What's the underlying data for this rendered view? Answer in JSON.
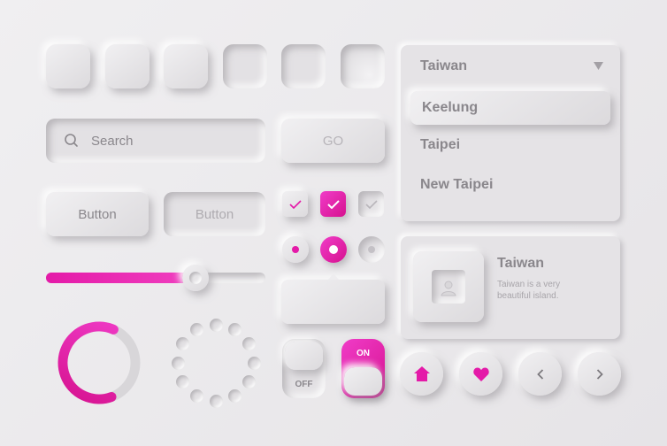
{
  "search": {
    "placeholder": "Search"
  },
  "go_button": {
    "label": "GO"
  },
  "buttons": [
    {
      "label": "Button"
    },
    {
      "label": "Button"
    }
  ],
  "slider": {
    "value_fraction": 0.68
  },
  "progress": {
    "value_fraction": 0.62
  },
  "dropdown": {
    "selected": "Taiwan",
    "options": [
      "Keelung",
      "Taipei",
      "New Taipei"
    ]
  },
  "card": {
    "title": "Taiwan",
    "description_line1": "Taiwan is a very",
    "description_line2": "beautiful island."
  },
  "toggles": [
    {
      "label": "OFF"
    },
    {
      "label": "ON"
    }
  ],
  "icons": [
    "search-icon",
    "check-icon",
    "home-icon",
    "heart-icon",
    "chevron-left-icon",
    "chevron-right-icon",
    "image-placeholder-icon",
    "dropdown-arrow-icon"
  ],
  "colors": {
    "accent": "#e41aa8",
    "background": "#ebe9eb",
    "text": "#8a878c"
  }
}
